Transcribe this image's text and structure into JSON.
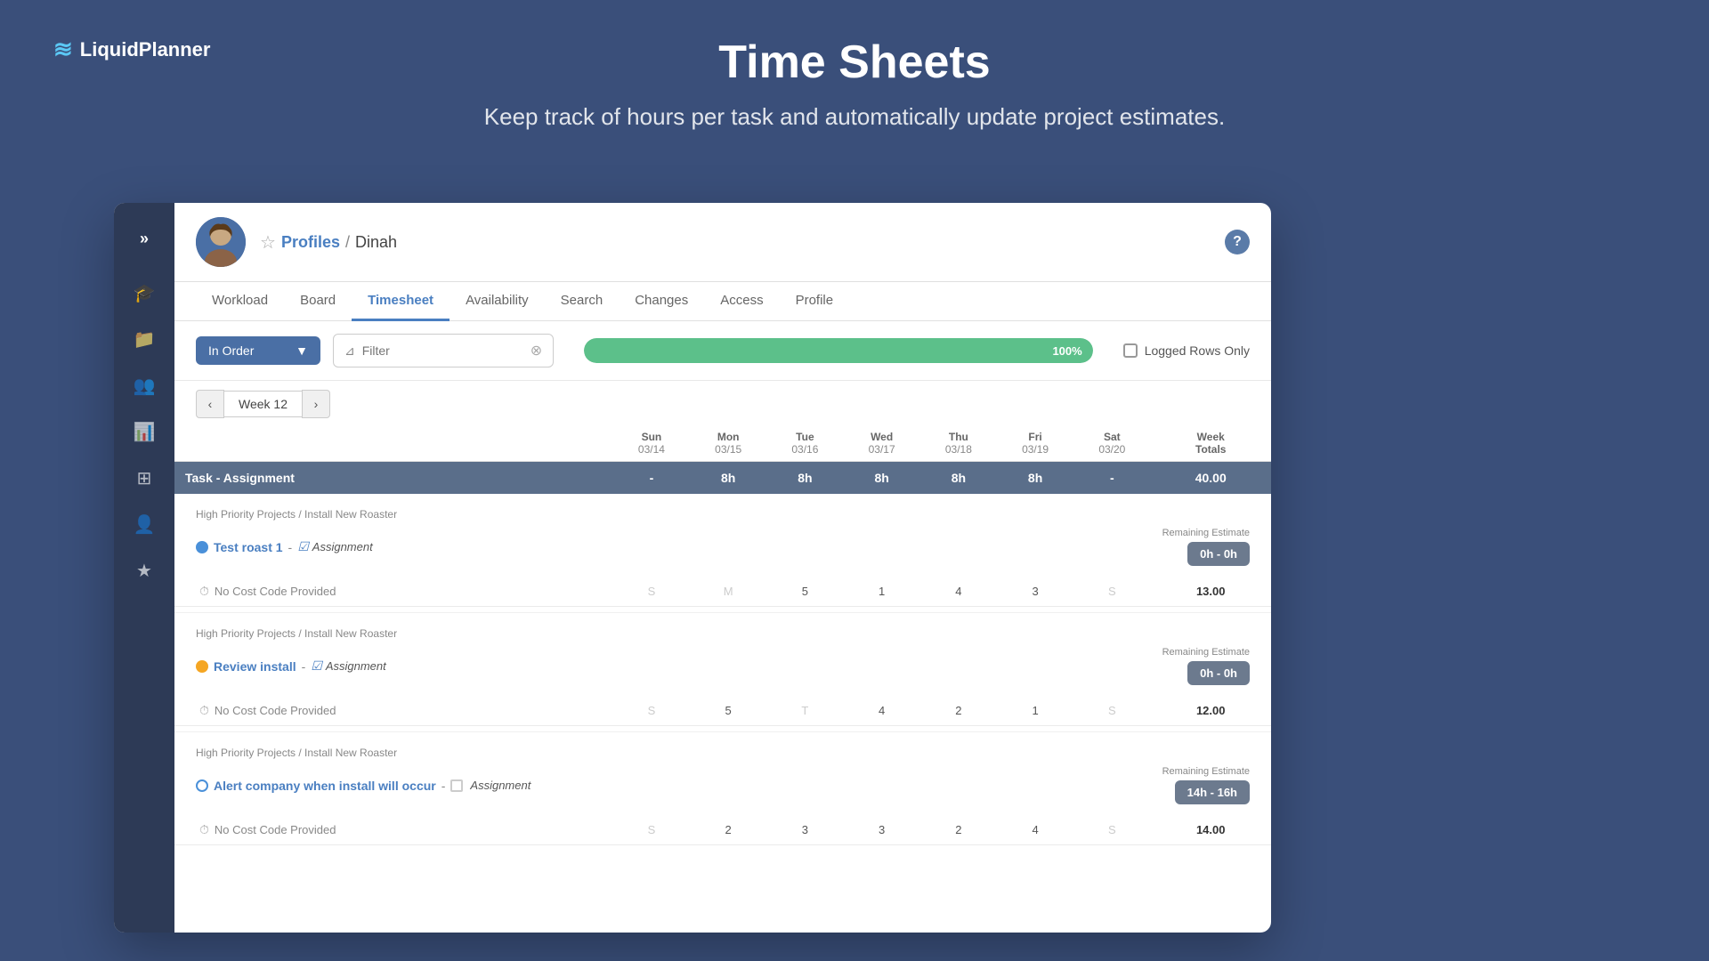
{
  "logo": {
    "icon": "≋",
    "text_bold": "Liquid",
    "text_regular": "Planner"
  },
  "hero": {
    "title": "Time Sheets",
    "subtitle": "Keep track of hours per task and automatically update project estimates."
  },
  "profile": {
    "breadcrumb_profiles": "Profiles",
    "breadcrumb_sep": "/",
    "breadcrumb_name": "Dinah"
  },
  "nav_tabs": [
    {
      "id": "workload",
      "label": "Workload"
    },
    {
      "id": "board",
      "label": "Board"
    },
    {
      "id": "timesheet",
      "label": "Timesheet",
      "active": true
    },
    {
      "id": "availability",
      "label": "Availability"
    },
    {
      "id": "search",
      "label": "Search"
    },
    {
      "id": "changes",
      "label": "Changes"
    },
    {
      "id": "access",
      "label": "Access"
    },
    {
      "id": "profile",
      "label": "Profile"
    }
  ],
  "toolbar": {
    "sort_label": "In Order",
    "filter_placeholder": "Filter",
    "progress_pct": "100%",
    "logged_rows_label": "Logged Rows Only"
  },
  "week": {
    "label": "Week 12",
    "days": [
      {
        "name": "Sun",
        "date": "03/14"
      },
      {
        "name": "Mon",
        "date": "03/15"
      },
      {
        "name": "Tue",
        "date": "03/16"
      },
      {
        "name": "Wed",
        "date": "03/17"
      },
      {
        "name": "Thu",
        "date": "03/18"
      },
      {
        "name": "Fri",
        "date": "03/19"
      },
      {
        "name": "Sat",
        "date": "03/20"
      }
    ],
    "week_totals_label": "Week\nTotals"
  },
  "task_summary_row": {
    "label": "Task - Assignment",
    "sun": "-",
    "mon": "8h",
    "tue": "8h",
    "wed": "8h",
    "thu": "8h",
    "fri": "8h",
    "sat": "-",
    "total": "40.00"
  },
  "rows": [
    {
      "project_path": "High Priority Projects / Install New Roaster",
      "task_link": "Test roast 1",
      "task_type": "blue",
      "assignment_checked": true,
      "assignment_label": "Assignment",
      "remaining_label": "Remaining Estimate",
      "remaining_value": "0h - 0h",
      "cost_code": "No Cost Code Provided",
      "sun": "S",
      "mon": "M",
      "tue": "5",
      "wed": "1",
      "thu": "4",
      "fri": "3",
      "sat": "S",
      "total": "13.00"
    },
    {
      "project_path": "High Priority Projects / Install New Roaster",
      "task_link": "Review install",
      "task_type": "orange",
      "assignment_checked": true,
      "assignment_label": "Assignment",
      "remaining_label": "Remaining Estimate",
      "remaining_value": "0h - 0h",
      "cost_code": "No Cost Code Provided",
      "sun": "S",
      "mon": "5",
      "tue": "T",
      "wed": "4",
      "thu": "2",
      "fri": "1",
      "sat": "S",
      "total": "12.00"
    },
    {
      "project_path": "High Priority Projects / Install New Roaster",
      "task_link": "Alert company when install will occur",
      "task_type": "blue2",
      "assignment_checked": false,
      "assignment_label": "Assignment",
      "remaining_label": "Remaining Estimate",
      "remaining_value": "14h - 16h",
      "cost_code": "No Cost Code Provided",
      "sun": "S",
      "mon": "2",
      "tue": "3",
      "wed": "3",
      "thu": "2",
      "fri": "4",
      "sat": "S",
      "total": "14.00"
    }
  ],
  "sidebar": {
    "chevron": "»",
    "items": [
      {
        "id": "learn",
        "icon": "🎓"
      },
      {
        "id": "folder",
        "icon": "📁"
      },
      {
        "id": "team",
        "icon": "👥"
      },
      {
        "id": "chart",
        "icon": "📊"
      },
      {
        "id": "grid",
        "icon": "⊞"
      },
      {
        "id": "person",
        "icon": "👤"
      },
      {
        "id": "star",
        "icon": "★"
      }
    ]
  }
}
